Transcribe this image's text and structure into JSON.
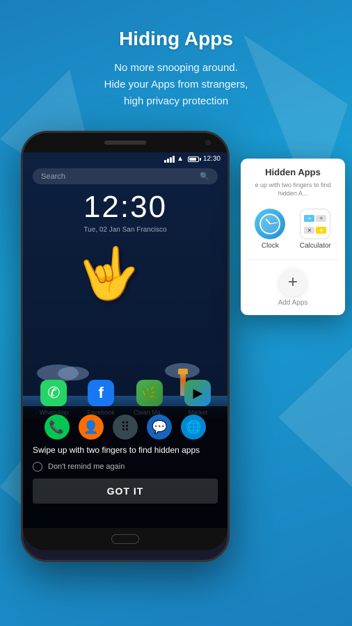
{
  "header": {
    "title": "Hiding Apps",
    "subtitle": "No more snooping around.\nHide your Apps from strangers,\nhigh privacy protection"
  },
  "phone": {
    "status_bar": {
      "time": "12:30",
      "signal": "full",
      "wifi": true,
      "battery": "70%"
    },
    "search_placeholder": "Search",
    "clock_time": "12:30",
    "clock_date": "Tue, 02 Jan San Francisco",
    "apps": [
      {
        "name": "WhatsApp",
        "color": "#25D366"
      },
      {
        "name": "Facebook",
        "color": "#1877F2"
      },
      {
        "name": "Clean Ma...",
        "color": "#4CAF50"
      },
      {
        "name": "Market",
        "color": "#43a047"
      }
    ],
    "tooltip": {
      "text": "Swipe up with two fingers to find hidden apps",
      "checkbox_label": "Don't remind me again",
      "button_label": "GOT IT"
    }
  },
  "hidden_panel": {
    "title": "Hidden Apps",
    "subtitle": "e up with two fingers to find hidden A...",
    "apps": [
      {
        "name": "Clock"
      },
      {
        "name": "Calculator"
      }
    ],
    "add_label": "Add Apps"
  }
}
